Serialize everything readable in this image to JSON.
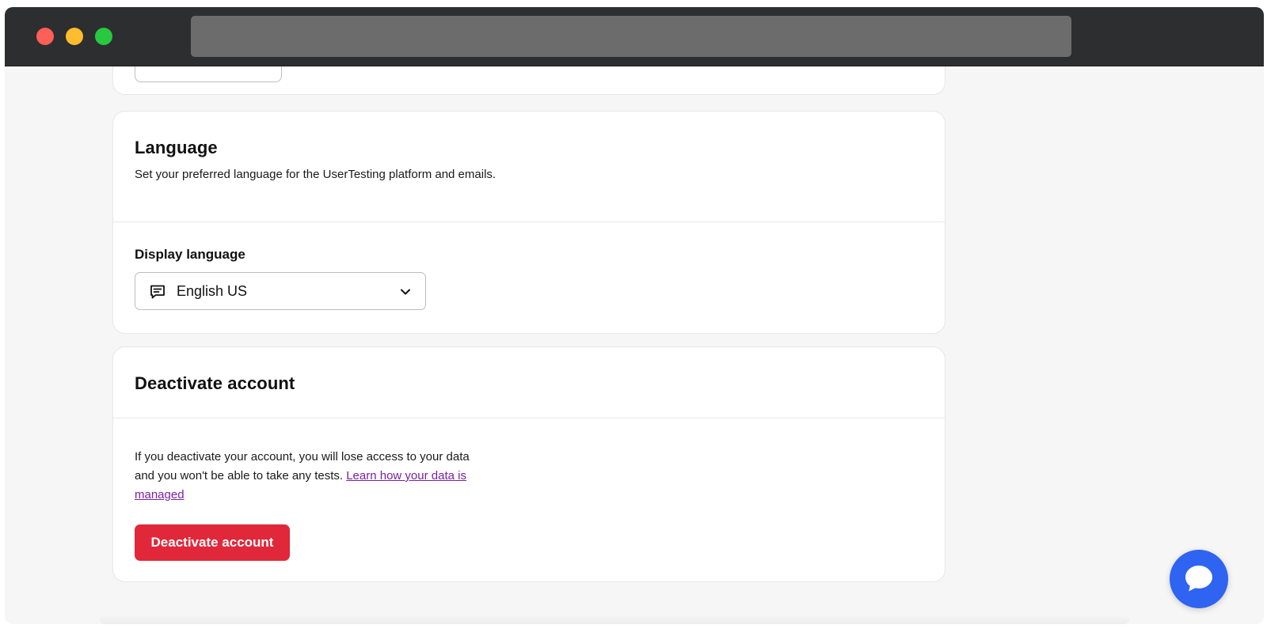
{
  "language_section": {
    "title": "Language",
    "description": "Set your preferred language for the UserTesting platform and emails.",
    "field_label": "Display language",
    "selected_language": "English US",
    "icons": [
      "chat-icon",
      "chevron-down-icon"
    ]
  },
  "deactivate_section": {
    "title": "Deactivate account",
    "description_before_link": "If you deactivate your account, you will lose access to your data and you won't be able to take any tests. ",
    "link_text": "Learn how your data is managed",
    "button_label": "Deactivate account",
    "button_color": "#e0283a",
    "link_color": "#7a1fa2"
  },
  "chat_widget": {
    "icon": "chat-bubble-icon",
    "color": "#2f63f1"
  }
}
